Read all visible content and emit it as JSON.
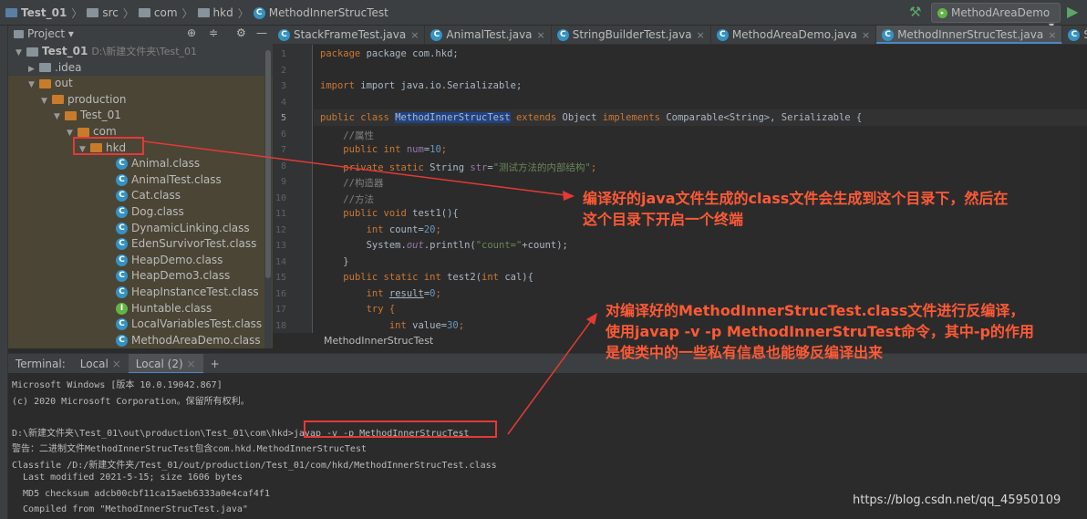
{
  "breadcrumb": [
    "Test_01",
    "src",
    "com",
    "hkd",
    "MethodInnerStrucTest"
  ],
  "run_config": "MethodAreaDemo",
  "project_panel": {
    "title": "Project"
  },
  "tree": [
    {
      "label": "Test_01",
      "path": "D:\\新建文件夹\\Test_01",
      "icon": "folder",
      "bold": true
    },
    {
      "label": ".idea",
      "icon": "folder"
    },
    {
      "label": "out",
      "icon": "folder-orange"
    },
    {
      "label": "production",
      "icon": "folder-orange"
    },
    {
      "label": "Test_01",
      "icon": "folder-orange"
    },
    {
      "label": "com",
      "icon": "folder-orange"
    },
    {
      "label": "hkd",
      "icon": "folder-orange"
    },
    {
      "label": "Animal.class",
      "icon": "class"
    },
    {
      "label": "AnimalTest.class",
      "icon": "class"
    },
    {
      "label": "Cat.class",
      "icon": "class"
    },
    {
      "label": "Dog.class",
      "icon": "class"
    },
    {
      "label": "DynamicLinking.class",
      "icon": "class"
    },
    {
      "label": "EdenSurvivorTest.class",
      "icon": "class"
    },
    {
      "label": "HeapDemo.class",
      "icon": "class"
    },
    {
      "label": "HeapDemo3.class",
      "icon": "class"
    },
    {
      "label": "HeapInstanceTest.class",
      "icon": "class"
    },
    {
      "label": "Huntable.class",
      "icon": "interface"
    },
    {
      "label": "LocalVariablesTest.class",
      "icon": "class"
    },
    {
      "label": "MethodAreaDemo.class",
      "icon": "class"
    }
  ],
  "tabs": [
    "StackFrameTest.java",
    "AnimalTest.java",
    "StringBuilderTest.java",
    "MethodAreaDemo.java",
    "MethodInnerStrucTest.java",
    "SimpleHeap.java"
  ],
  "active_tab": "MethodInnerStrucTest.java",
  "line_numbers": [
    "1",
    "2",
    "3",
    "4",
    "5",
    "6",
    "7",
    "8",
    "9",
    "10",
    "11",
    "12",
    "13",
    "14",
    "15",
    "16",
    "17",
    "18"
  ],
  "code": {
    "l1": "package com.hkd;",
    "l3": "import java.io.Serializable;",
    "l5_class": "MethodInnerStrucTest",
    "l5_rest": " Object ",
    "l5_tail": " Comparable<String>, Serializable {",
    "l6": "//属性",
    "l7_field": "num",
    "l7_val": "10",
    "l8_field": "str",
    "l8_val": "\"测试方法的内部结构\"",
    "l9": "//构造器",
    "l10": "//方法",
    "l11": "test1(){",
    "l12_val": "20",
    "l13_pre": "System.",
    "l13_out": "out",
    "l13_mid": ".println(",
    "l13_str": "\"count=\"",
    "l13_end": "+count);",
    "l14": "}",
    "l15": "test2(",
    "l15_b": " cal){",
    "l16_var": "result",
    "l16_val": "0",
    "l17": "try {",
    "l18_val": "30"
  },
  "editor_breadcrumb": "MethodInnerStrucTest",
  "terminal": {
    "label": "Terminal:",
    "tabs": [
      "Local",
      "Local (2)"
    ],
    "lines": [
      "Microsoft Windows [版本 10.0.19042.867]",
      "(c) 2020 Microsoft Corporation。保留所有权利。",
      "",
      "D:\\新建文件夹\\Test_01\\out\\production\\Test_01\\com\\hkd>",
      "警告：二进制文件MethodInnerStrucTest包含com.hkd.MethodInnerStrucTest",
      "Classfile /D:/新建文件夹/Test_01/out/production/Test_01/com/hkd/MethodInnerStrucTest.class",
      "  Last modified 2021-5-15; size 1606 bytes",
      "  MD5 checksum adcb00cbf11ca15aeb6333a0e4caf4f1",
      "  Compiled from \"MethodInnerStrucTest.java\""
    ],
    "command": "javap -v -p MethodInnerStrucTest"
  },
  "annotations": {
    "a1": [
      "编译好的java文件生成的class文件会生成到这个目录下，然后在",
      "这个目录下开启一个终端"
    ],
    "a2": [
      "对编译好的MethodInnerStrucTest.class文件进行反编译，",
      "使用javap -v -p MethodInnerStruTest命令，其中-p的作用",
      "是使类中的一些私有信息也能够反编译出来"
    ]
  },
  "watermark": "https://blog.csdn.net/qq_45950109",
  "colors": {
    "annotation": "#ff5a36",
    "box": "#e53935",
    "accent": "#4a88c7"
  }
}
